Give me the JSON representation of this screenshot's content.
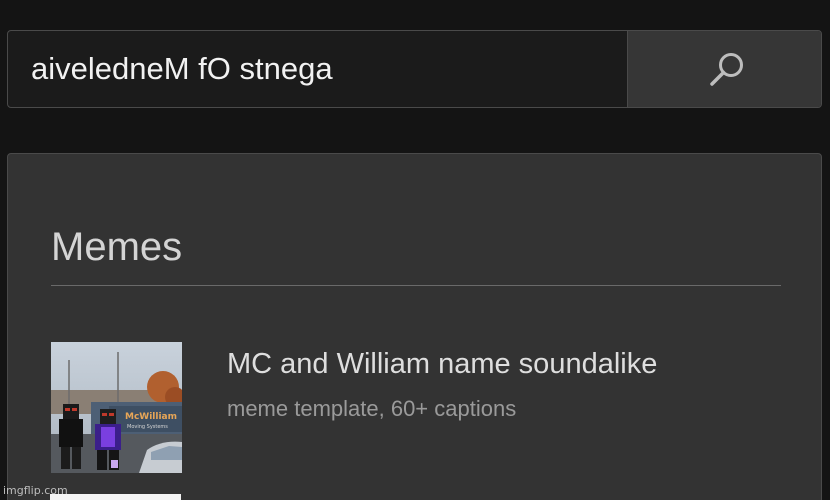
{
  "search": {
    "value": "aiveledneM fO stnega",
    "icon": "search-icon"
  },
  "results": {
    "section_title": "Memes",
    "items": [
      {
        "title": "MC and William name soundalike",
        "subtitle": "meme template, 60+ captions",
        "thumbnail_caption": "McWilliam",
        "thumbnail_subcaption": "Moving Systems"
      }
    ]
  },
  "watermark": "imgflip.com",
  "colors": {
    "background": "#141414",
    "panel": "#333333",
    "search_button": "#363636",
    "text_primary": "#dedede",
    "text_secondary": "#9a9a9a"
  }
}
